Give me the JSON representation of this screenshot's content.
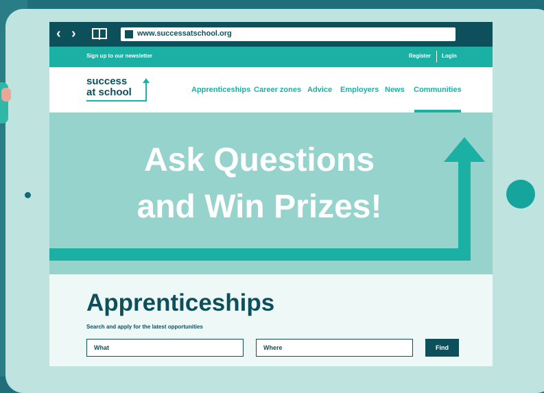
{
  "browser": {
    "url": "www.successatschool.org",
    "back_icon": "chevron-left-icon",
    "forward_icon": "chevron-right-icon",
    "bookmarks_icon": "book-icon"
  },
  "topbar": {
    "newsletter": "Sign up to our newsletter",
    "register": "Register",
    "login": "Login"
  },
  "logo": {
    "line1": "success",
    "line2": "at school"
  },
  "nav": {
    "items": [
      {
        "label": "Apprenticeships"
      },
      {
        "label": "Career zones"
      },
      {
        "label": "Advice"
      },
      {
        "label": "Employers"
      },
      {
        "label": "News"
      },
      {
        "label": "Communities"
      }
    ],
    "active": "Communities"
  },
  "hero": {
    "line1": "Ask Questions",
    "line2": "and Win Prizes!"
  },
  "section": {
    "title": "Apprenticeships",
    "subtitle": "Search and apply for the latest opportunities",
    "what_placeholder": "What",
    "where_placeholder": "Where",
    "find_label": "Find"
  },
  "colors": {
    "dark_teal": "#0e4f5c",
    "accent_teal": "#1ab0a3",
    "hero_bg": "#96d3cd",
    "tablet_frame": "#bfe3df"
  }
}
